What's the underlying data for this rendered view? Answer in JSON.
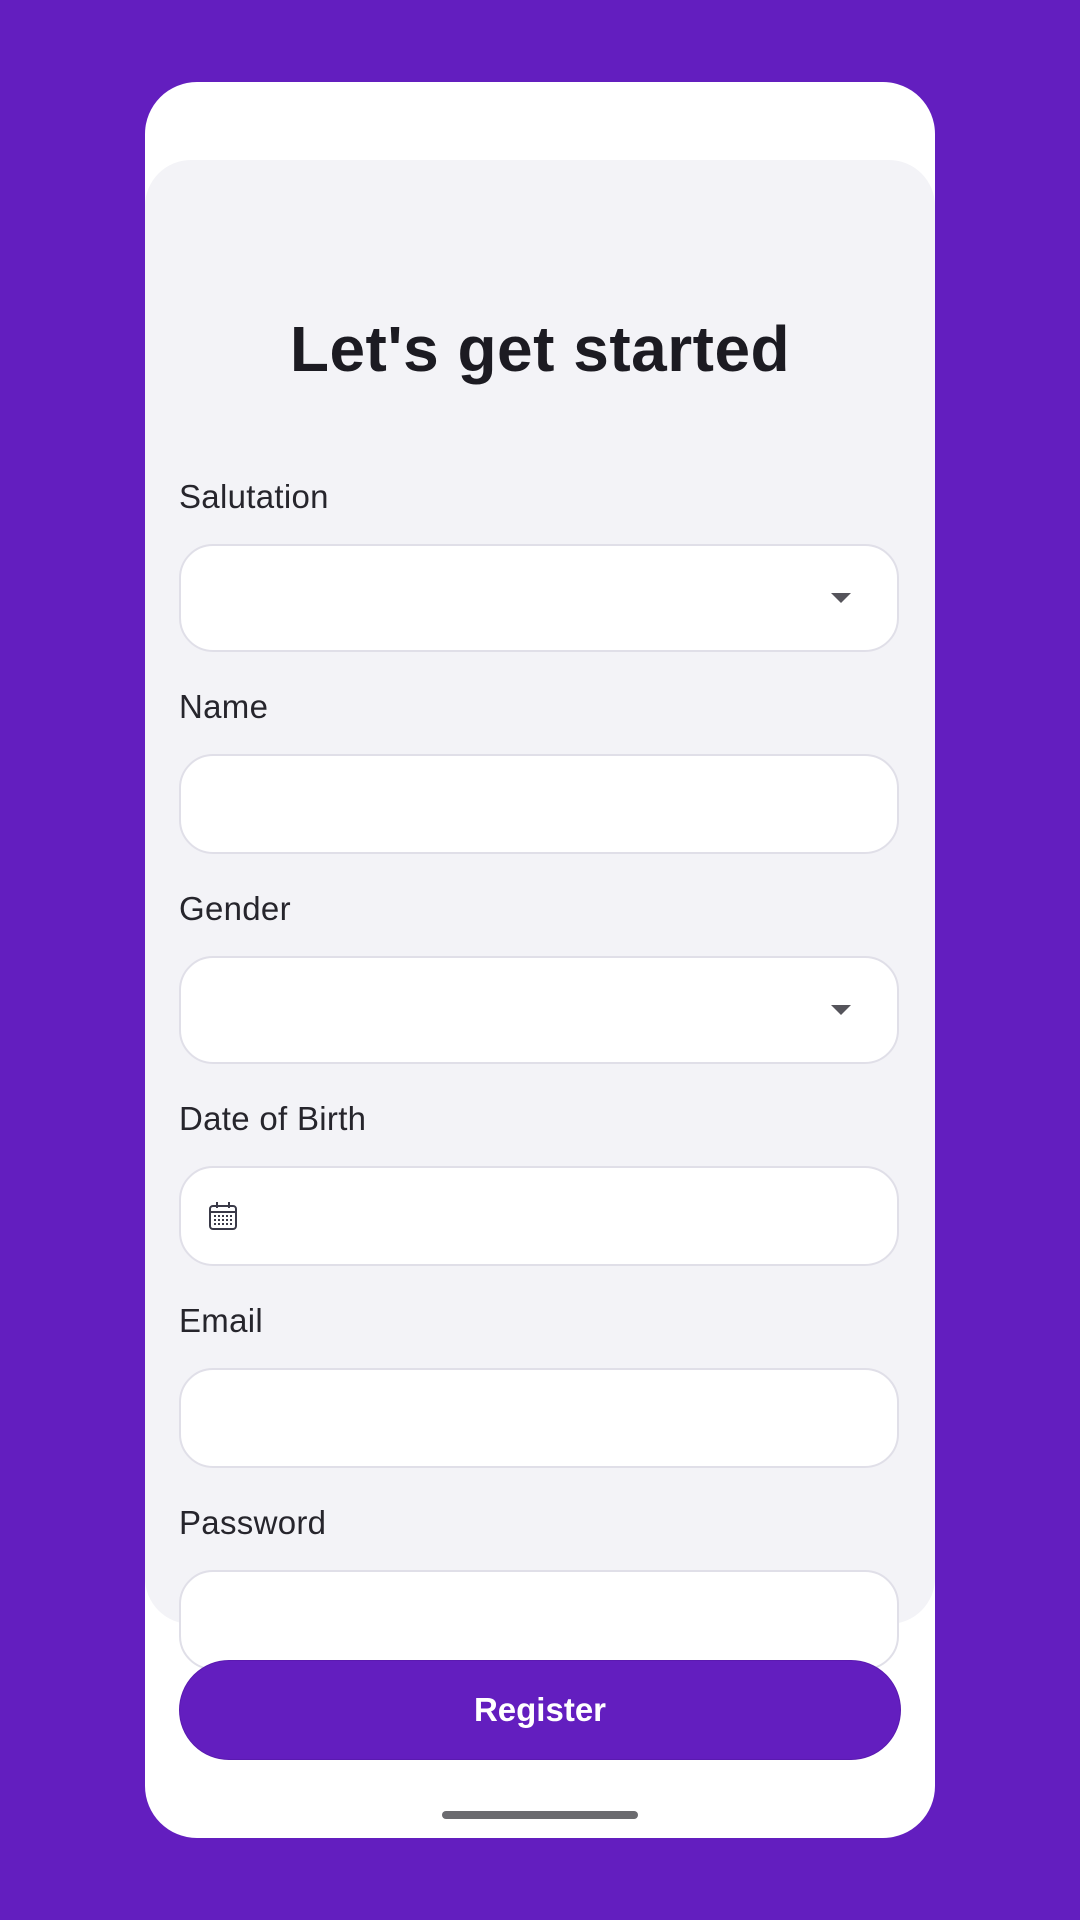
{
  "form": {
    "title": "Let's get started",
    "fields": {
      "salutation": {
        "label": "Salutation",
        "value": ""
      },
      "name": {
        "label": "Name",
        "value": ""
      },
      "gender": {
        "label": "Gender",
        "value": ""
      },
      "date_of_birth": {
        "label": "Date of Birth",
        "value": ""
      },
      "email": {
        "label": "Email",
        "value": ""
      },
      "password": {
        "label": "Password",
        "value": ""
      }
    },
    "submit_label": "Register"
  },
  "icons": {
    "dropdown": "chevron-down-icon",
    "date": "calendar-icon"
  },
  "colors": {
    "brand": "#631ebf",
    "card_background": "#f3f3f7",
    "field_border": "#e0dfe8"
  }
}
